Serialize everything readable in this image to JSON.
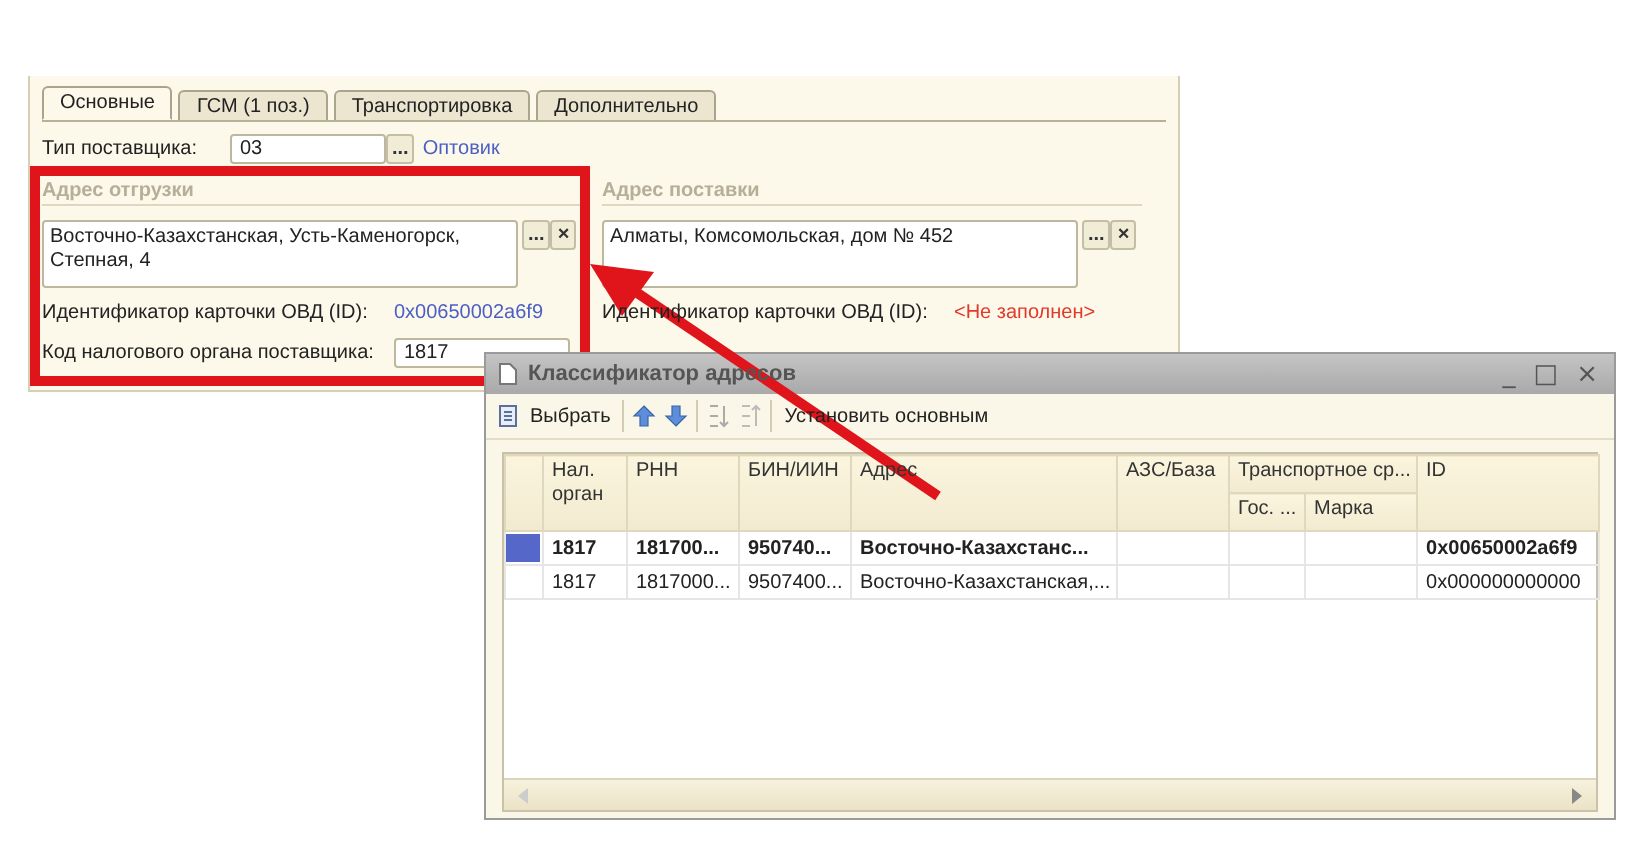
{
  "tabs": [
    {
      "label": "Основные",
      "selected": true
    },
    {
      "label": "ГСМ (1 поз.)",
      "selected": false
    },
    {
      "label": "Транспортировка",
      "selected": false
    },
    {
      "label": "Дополнительно",
      "selected": false
    }
  ],
  "supplier_type": {
    "label": "Тип поставщика:",
    "value": "03",
    "choose": "...",
    "link": "Оптовик"
  },
  "groups": [
    {
      "title": "Адрес отгрузки",
      "address": "Восточно-Казахстанская, Усть-Каменогорск, Степная, 4",
      "choose": "...",
      "clear": "×",
      "id_label": "Идентификатор карточки ОВД (ID):",
      "id_value": "0x00650002a6f9",
      "missing": false,
      "code_label": "Код налогового органа поставщика:",
      "code_value": "1817"
    },
    {
      "title": "Адрес поставки",
      "address": "Алматы, Комсомольская, дом № 452",
      "choose": "...",
      "clear": "×",
      "id_label": "Идентификатор карточки ОВД (ID):",
      "id_value": "<Не заполнен>",
      "missing": true
    }
  ],
  "popup": {
    "title": "Классификатор адресов",
    "controls": [
      "_",
      "□",
      "×"
    ],
    "toolbar": [
      {
        "kind": "select",
        "label": "Выбрать"
      },
      {
        "kind": "separator"
      },
      {
        "kind": "move-up"
      },
      {
        "kind": "move-down"
      },
      {
        "kind": "separator"
      },
      {
        "kind": "sort-asc"
      },
      {
        "kind": "sort-desc"
      },
      {
        "kind": "separator"
      },
      {
        "kind": "text",
        "label": "Установить основным"
      }
    ],
    "columns": [
      {
        "label": "Нал. орган"
      },
      {
        "label": "РНН"
      },
      {
        "label": "БИН/ИИН"
      },
      {
        "label": "Адрес"
      },
      {
        "label": "АЗС/База"
      },
      {
        "label": "Транспортное ср...",
        "children": [
          "Гос. ...",
          "Марка"
        ]
      },
      {
        "label": "ID"
      }
    ],
    "rows": [
      {
        "selected": true,
        "cells": [
          "1817",
          "181700...",
          "950740...",
          "Восточно-Казахстанс...",
          "",
          "",
          "",
          "0x00650002a6f9"
        ]
      },
      {
        "selected": false,
        "cells": [
          "1817",
          "1817000...",
          "9507400...",
          "Восточно-Казахстанская,...",
          "",
          "",
          "",
          "0x000000000000"
        ]
      }
    ]
  }
}
